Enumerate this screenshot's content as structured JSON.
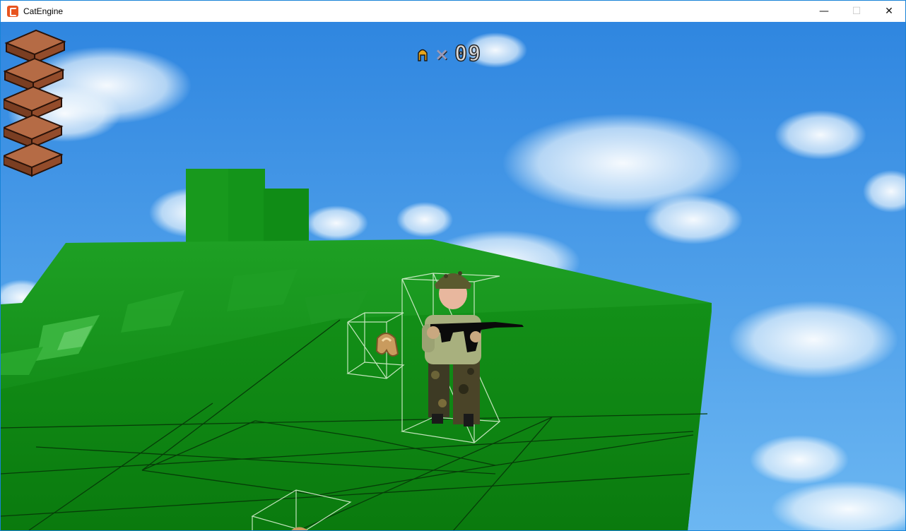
{
  "window": {
    "title": "CatEngine",
    "minimize_glyph": "—",
    "maximize_glyph": "☐",
    "close_glyph": "✕"
  },
  "hud": {
    "bricks_count": 5,
    "ammo_icon": "bullet-icon",
    "multiplier": "×",
    "ammo_count": "09"
  },
  "colors": {
    "sky": "#4a9ee8",
    "grass": "#0f8a12",
    "brick": "#8a4a2e",
    "wireframe": "#d8e8d0"
  }
}
